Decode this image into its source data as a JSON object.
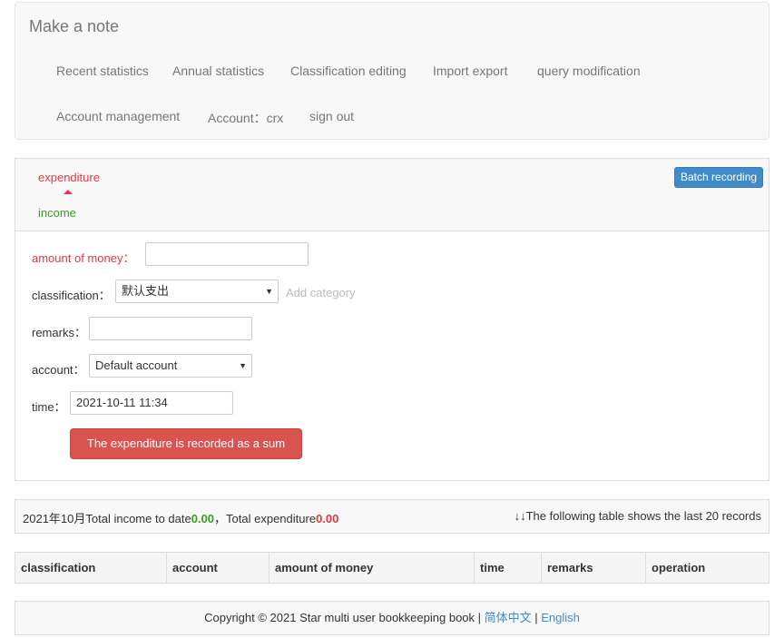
{
  "nav": {
    "brand": "Make a note",
    "items": [
      "Recent statistics",
      "Annual statistics",
      "Classification editing",
      "Import export",
      "query modification",
      "Account management",
      "Account：crx",
      "sign out"
    ]
  },
  "tabs": {
    "expenditure": "expenditure",
    "income": "income"
  },
  "batch_button": "Batch recording",
  "form": {
    "amount_label": "amount of money：",
    "amount_value": "",
    "classification_label": "classification：",
    "classification_value": "默认支出",
    "add_category": "Add category",
    "remarks_label": "remarks：",
    "remarks_value": "",
    "account_label": "account：",
    "account_value": "Default account",
    "time_label": "time：",
    "time_value": "2021-10-11 11:34",
    "submit": "The expenditure is recorded as a sum"
  },
  "summary": {
    "prefix": "2021年10月Total income to date",
    "income": "0.00",
    "middle": "，Total expenditure",
    "expenditure": "0.00",
    "note": "↓↓The following table shows the last 20 records"
  },
  "table": {
    "headers": [
      "classification",
      "account",
      "amount of money",
      "time",
      "remarks",
      "operation"
    ],
    "rows": []
  },
  "footer": {
    "text": "Copyright © 2021 Star multi user bookkeeping book | ",
    "lang_cn": "简体中文",
    "separator": " | ",
    "lang_en": "English"
  },
  "colors": {
    "expenditure": "#e4393c",
    "income": "#3c9a26",
    "primary": "#428bca",
    "danger": "#d9534f"
  }
}
